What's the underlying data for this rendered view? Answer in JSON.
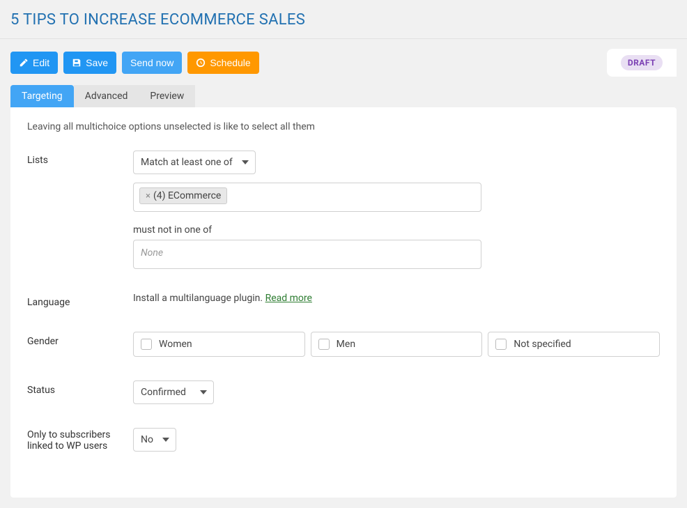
{
  "header": {
    "title": "5 TIPS TO INCREASE ECOMMERCE SALES"
  },
  "toolbar": {
    "edit": "Edit",
    "save": "Save",
    "send_now": "Send now",
    "schedule": "Schedule",
    "status_badge": "DRAFT"
  },
  "tabs": [
    {
      "key": "targeting",
      "label": "Targeting",
      "active": true
    },
    {
      "key": "advanced",
      "label": "Advanced",
      "active": false
    },
    {
      "key": "preview",
      "label": "Preview",
      "active": false
    }
  ],
  "targeting": {
    "hint": "Leaving all multichoice options unselected is like to select all them",
    "labels": {
      "lists": "Lists",
      "language": "Language",
      "gender": "Gender",
      "status": "Status",
      "wp_users": "Only to subscribers linked to WP users"
    },
    "lists": {
      "match_mode": "Match at least one of",
      "selected": [
        "(4) ECommerce"
      ],
      "not_in_label": "must not in one of",
      "not_in_placeholder": "None"
    },
    "language": {
      "text_before": "Install a multilanguage plugin. ",
      "link": "Read more"
    },
    "gender": {
      "options": [
        "Women",
        "Men",
        "Not specified"
      ]
    },
    "status": {
      "value": "Confirmed"
    },
    "wp_users": {
      "value": "No"
    }
  }
}
